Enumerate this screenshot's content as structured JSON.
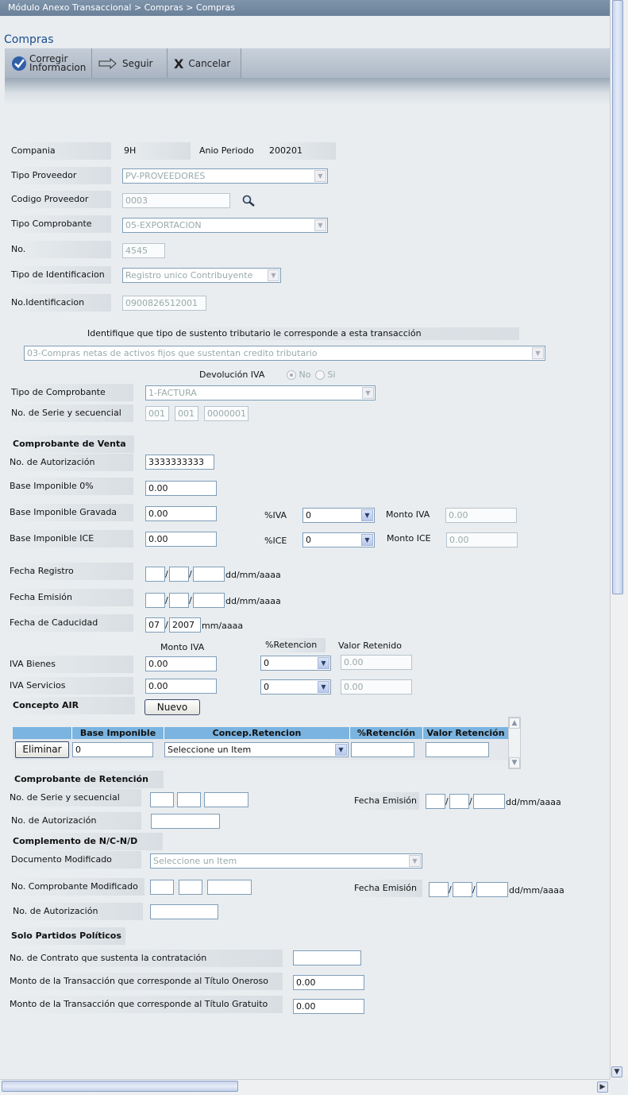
{
  "breadcrumb": "Módulo Anexo Transaccional > Compras > Compras",
  "page_title": "Compras",
  "toolbar": {
    "corregir_line1": "Corregir",
    "corregir_line2": "Informacion",
    "seguir": "Seguir",
    "cancelar": "Cancelar"
  },
  "header": {
    "compania_label": "Compania",
    "compania_value": "9H",
    "anio_label": "Anio Periodo",
    "anio_value": "200201"
  },
  "proveedor": {
    "tipo_proveedor_label": "Tipo Proveedor",
    "tipo_proveedor_value": "PV-PROVEEDORES",
    "codigo_label": "Codigo Proveedor",
    "codigo_value": "0003",
    "tipo_comprobante_label": "Tipo Comprobante",
    "tipo_comprobante_value": "05-EXPORTACION",
    "no_label": "No.",
    "no_value": "4545",
    "tipo_ident_label": "Tipo de Identificacion",
    "tipo_ident_value": "Registro unico Contribuyente",
    "no_ident_label": "No.Identificacion",
    "no_ident_value": "0900826512001"
  },
  "sustento": {
    "question": "Identifique que tipo de sustento tributario le corresponde a esta transacción",
    "value": "03-Compras netas de activos fijos que sustentan credito tributario"
  },
  "devolucion": {
    "label": "Devolución IVA",
    "no": "No",
    "si": "Si"
  },
  "comprobante": {
    "tipo_label": "Tipo de Comprobante",
    "tipo_value": "1-FACTURA",
    "serie_label": "No. de Serie y secuencial",
    "serie1": "001",
    "serie2": "001",
    "secuencial": "0000001"
  },
  "venta": {
    "heading": "Comprobante de Venta",
    "autorizacion_label": "No. de Autorización",
    "autorizacion_value": "3333333333",
    "base0_label": "Base Imponible 0%",
    "base0_value": "0.00",
    "gravada_label": "Base Imponible Gravada",
    "gravada_value": "0.00",
    "iva_pct_label": "%IVA",
    "iva_pct_value": "0",
    "monto_iva_label": "Monto IVA",
    "monto_iva_value": "0.00",
    "ice_label": "Base Imponible ICE",
    "ice_value": "0.00",
    "ice_pct_label": "%ICE",
    "ice_pct_value": "0",
    "monto_ice_label": "Monto ICE",
    "monto_ice_value": "0.00"
  },
  "fechas": {
    "registro_label": "Fecha Registro",
    "emision_label": "Fecha Emisión",
    "caducidad_label": "Fecha de Caducidad",
    "caducidad_mm": "07",
    "caducidad_aaaa": "2007",
    "fmt_full": "dd/mm/aaaa",
    "fmt_short": "mm/aaaa",
    "sep": "/"
  },
  "retencion_iva": {
    "monto_header": "Monto IVA",
    "pct_header": "%Retencion",
    "valor_header": "Valor Retenido",
    "bienes_label": "IVA Bienes",
    "bienes_monto": "0.00",
    "bienes_pct": "0",
    "bienes_valor": "0.00",
    "servicios_label": "IVA Servicios",
    "servicios_monto": "0.00",
    "servicios_pct": "0",
    "servicios_valor": "0.00"
  },
  "air": {
    "label": "Concepto AIR",
    "nuevo": "Nuevo",
    "col_base": "Base Imponible",
    "col_concep": "Concep.Retencion",
    "col_pct": "%Retención",
    "col_valor": "Valor Retención",
    "eliminar": "Eliminar",
    "base_value": "0",
    "concep_value": "Seleccione un Item"
  },
  "retencion": {
    "heading": "Comprobante de Retención",
    "serie_label": "No. de Serie y secuencial",
    "fecha_label": "Fecha Emisión",
    "autorizacion_label": "No. de Autorización"
  },
  "nc_nd": {
    "heading": "Complemento de N/C-N/D",
    "doc_label": "Documento Modificado",
    "doc_value": "Seleccione un Item",
    "comp_label": "No. Comprobante Modificado",
    "fecha_label": "Fecha Emisión",
    "autorizacion_label": "No. de Autorización"
  },
  "partidos": {
    "heading": "Solo Partidos Políticos",
    "contrato_label": "No. de Contrato que sustenta la contratación",
    "oneroso_label": "Monto de la Transacción que corresponde al Título Oneroso",
    "oneroso_value": "0.00",
    "gratuito_label": "Monto de la Transacción que corresponde al Título Gratuito",
    "gratuito_value": "0.00"
  }
}
